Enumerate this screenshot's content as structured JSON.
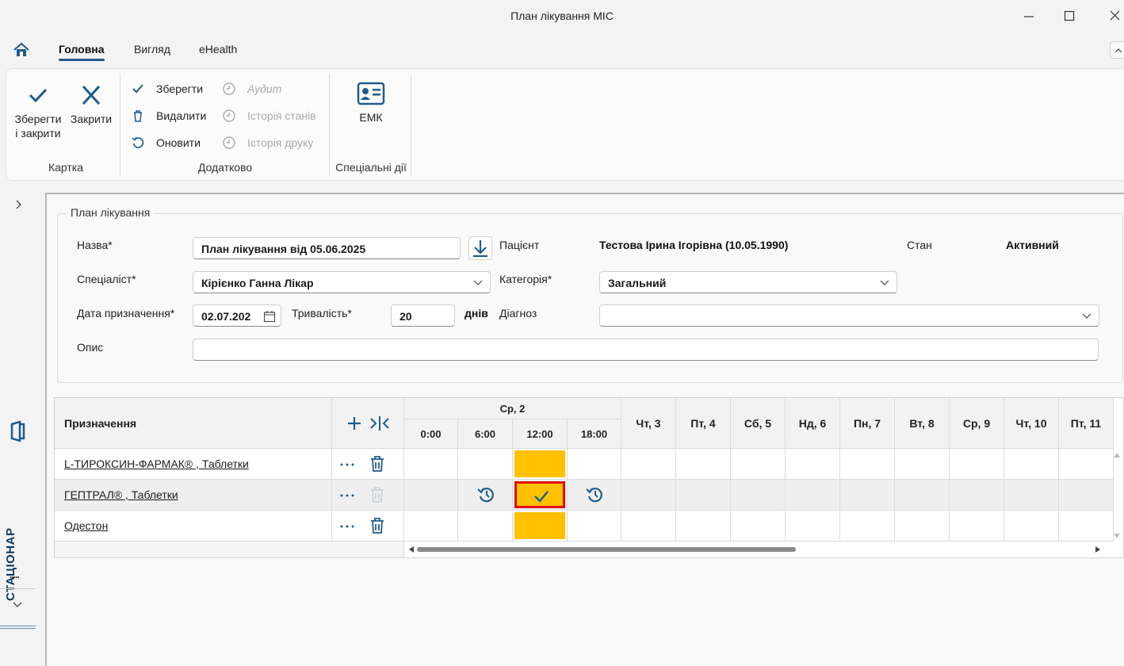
{
  "window": {
    "title": "План лікування МІС"
  },
  "ribbon_tabs": [
    {
      "label": "Головна",
      "active": true
    },
    {
      "label": "Вигляд",
      "active": false
    },
    {
      "label": "eHealth",
      "active": false
    }
  ],
  "ribbon": {
    "kartka": {
      "group_label": "Картка",
      "save_close_label_1": "Зберегти",
      "save_close_label_2": "і закрити",
      "close_label": "Закрити"
    },
    "dodatkovo": {
      "group_label": "Додатково",
      "save": "Зберегти",
      "delete": "Видалити",
      "refresh": "Оновити",
      "audit": "Аудит",
      "state_history": "Історія станів",
      "print_history": "Історія друку"
    },
    "special": {
      "group_label": "Спеціальні дії",
      "emk": "ЕМК"
    }
  },
  "rail": {
    "label": "СТАЦІОНАР",
    "dots": "....."
  },
  "form": {
    "groupbox_title": "План лікування",
    "name_label": "Назва*",
    "name_value": "План лікування від 05.06.2025",
    "patient_label": "Пацієнт",
    "patient_value": "Тестова Ірина Ігорівна (10.05.1990)",
    "state_label": "Стан",
    "state_value": "Активний",
    "specialist_label": "Спеціаліст*",
    "specialist_value": "Кірієнко Ганна Лікар",
    "category_label": "Категорія*",
    "category_value": "Загальний",
    "date_label": "Дата призначення*",
    "date_value": "02.07.202",
    "duration_label": "Тривалість*",
    "duration_value": "20",
    "days_label": "днів",
    "diagnosis_label": "Діагноз",
    "diagnosis_value": "",
    "description_label": "Опис",
    "description_value": ""
  },
  "grid": {
    "header_label": "Призначення",
    "day_group": "Ср, 2",
    "times": [
      "0:00",
      "6:00",
      "12:00",
      "18:00"
    ],
    "days": [
      "Чт, 3",
      "Пт, 4",
      "Сб, 5",
      "Нд, 6",
      "Пн, 7",
      "Вт, 8",
      "Ср, 9",
      "Чт, 10",
      "Пт, 11"
    ],
    "rows": [
      {
        "name": "L-ТИРОКСИН-ФАРМАК® , Таблетки"
      },
      {
        "name": "ГЕПТРАЛ® , Таблетки"
      },
      {
        "name": "Одестон"
      }
    ]
  },
  "colors": {
    "accent": "#1f5c8f",
    "scheduled": "#ffc000",
    "selected_border": "#e01010"
  }
}
